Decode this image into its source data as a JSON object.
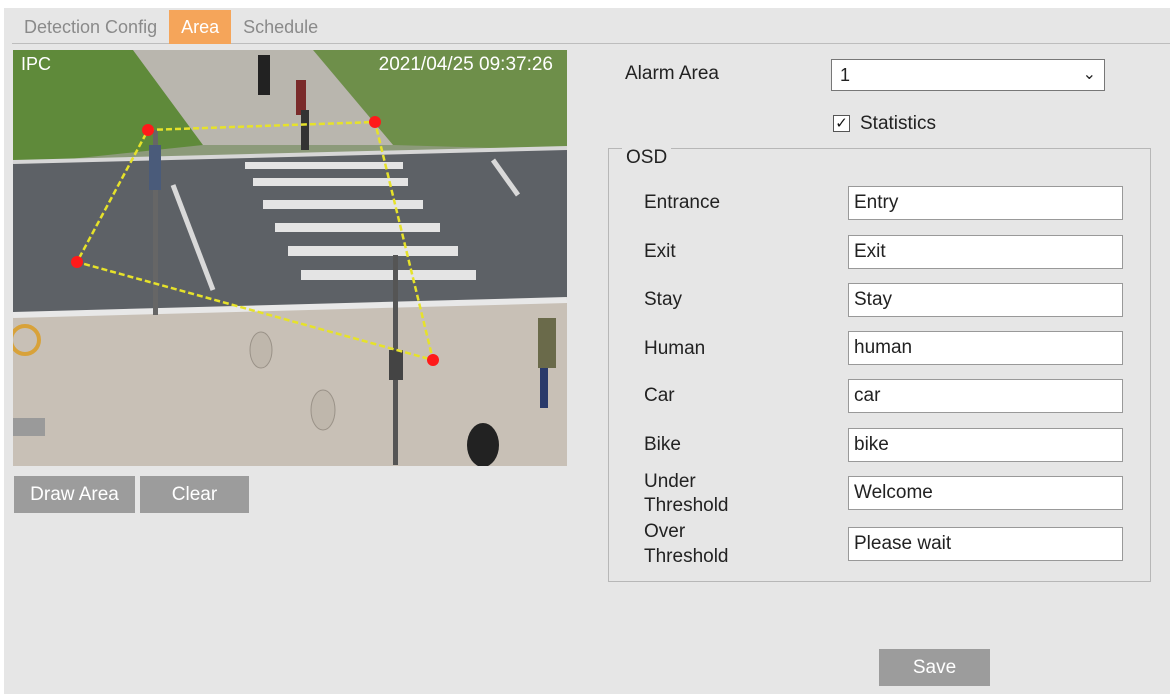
{
  "tabs": [
    {
      "label": "Detection Config"
    },
    {
      "label": "Area"
    },
    {
      "label": "Schedule"
    }
  ],
  "video": {
    "channel_name": "IPC",
    "timestamp": "2021/04/25 09:37:26"
  },
  "buttons": {
    "draw_area": "Draw Area",
    "clear": "Clear",
    "save": "Save"
  },
  "alarm_area": {
    "label": "Alarm Area",
    "value": "1"
  },
  "statistics": {
    "label": "Statistics",
    "checked": true
  },
  "osd": {
    "legend": "OSD",
    "fields": [
      {
        "label": "Entrance",
        "value": "Entry"
      },
      {
        "label": "Exit",
        "value": "Exit"
      },
      {
        "label": "Stay",
        "value": "Stay"
      },
      {
        "label": "Human",
        "value": "human"
      },
      {
        "label": "Car",
        "value": "car"
      },
      {
        "label": "Bike",
        "value": "bike"
      },
      {
        "label_line1": "Under",
        "label_line2": "Threshold",
        "value": "Welcome"
      },
      {
        "label_line1": "Over",
        "label_line2": "Threshold",
        "value": "Please wait"
      }
    ]
  },
  "colors": {
    "active_tab": "#f5a55a",
    "button": "#9c9c9c",
    "panel_bg": "#e6e6e6",
    "area_line": "#e6e22a",
    "area_point": "#ff1a1a"
  }
}
